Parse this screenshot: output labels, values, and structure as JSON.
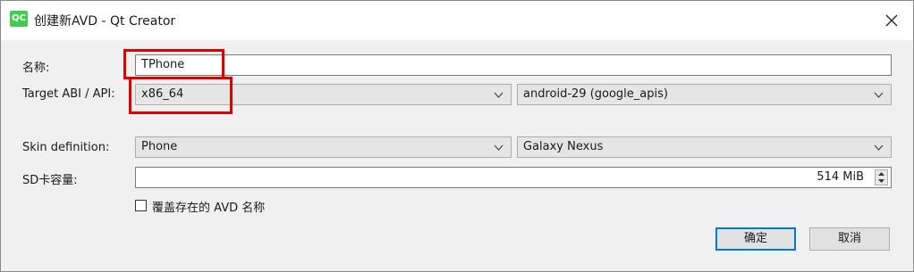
{
  "window": {
    "app_icon_text": "QC",
    "title": "创建新AVD - Qt Creator",
    "close_icon": "close-icon"
  },
  "form": {
    "name_label": "名称:",
    "name_value": "TPhone",
    "abi_label": "Target ABI / API:",
    "abi_value": "x86_64",
    "api_value": "android-29 (google_apis)",
    "skin_label": "Skin definition:",
    "skin_value": "Phone",
    "device_value": "Galaxy Nexus",
    "sd_label": "SD卡容量:",
    "sd_value": "514 MiB",
    "overwrite_label": "覆盖存在的 AVD 名称",
    "overwrite_checked": false
  },
  "buttons": {
    "ok_label": "确定",
    "cancel_label": "取消"
  },
  "colors": {
    "highlight": "#e00000",
    "qt_green": "#41cd52",
    "focus_blue": "#0078d7"
  }
}
